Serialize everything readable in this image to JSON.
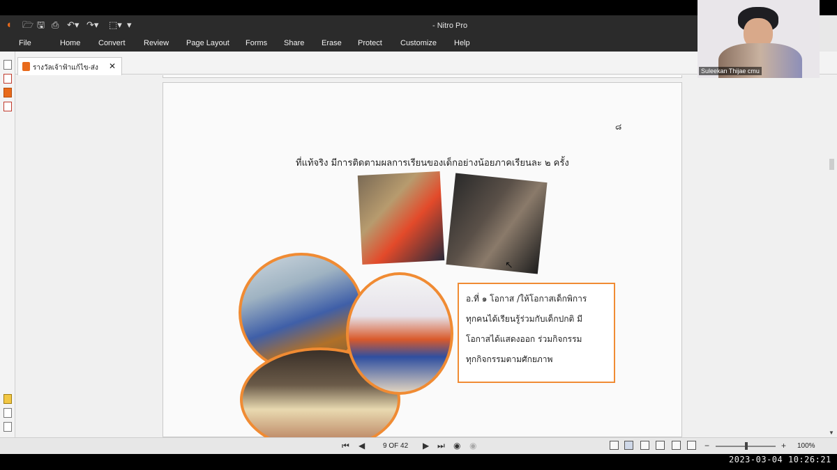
{
  "app": {
    "title": "- Nitro Pro"
  },
  "menu": [
    "File",
    "Home",
    "Convert",
    "Review",
    "Page Layout",
    "Forms",
    "Share",
    "Erase",
    "Protect",
    "Customize",
    "Help"
  ],
  "tab": {
    "label": "รางวัลเจ้าฟ้าแก้ไข-ส่ง",
    "close": "✕"
  },
  "document": {
    "page_number": "๘",
    "heading": "ที่แท้จริง มีการติดตามผลการเรียนของเด็กอย่างน้อยภาคเรียนละ ๒ ครั้ง",
    "callout_lines": [
      "อ.ที่ ๑  โอกาส /ให้โอกาสเด็กพิการ",
      "ทุกคนได้เรียนรู้ร่วมกับเด็กปกติ มี",
      "โอกาสได้แสดงออก ร่วมกิจกรรม",
      "ทุกกิจกรรมตามศักยภาพ"
    ],
    "accent_color": "#f08b33"
  },
  "statusbar": {
    "page_indicator": "9 OF 42",
    "zoom": "100%"
  },
  "webcam": {
    "name": "Suleekan Thijae cmu"
  },
  "timestamp": "2023-03-04  10:26:21",
  "colors": {
    "titlebar": "#2b2b2b",
    "nitro_orange": "#e86a1b"
  }
}
